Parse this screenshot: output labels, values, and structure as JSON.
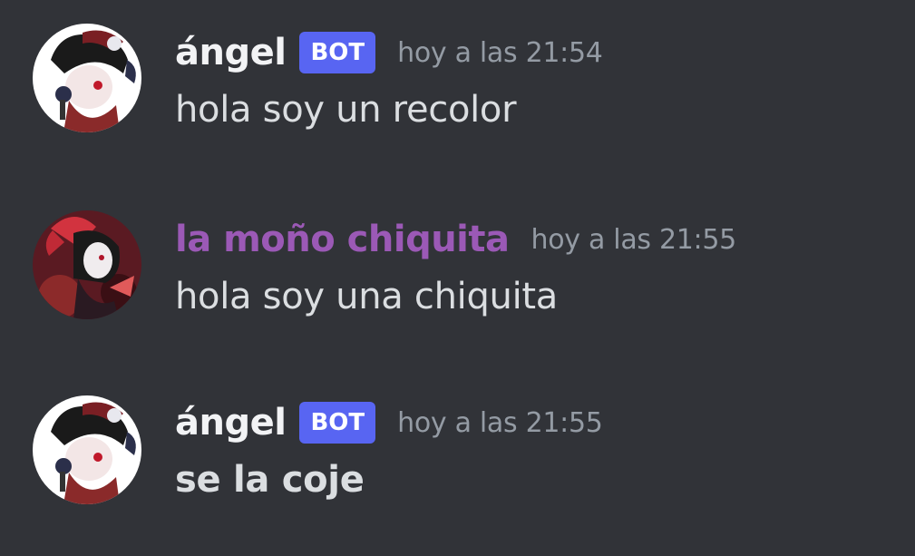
{
  "messages": [
    {
      "author": "ángel",
      "bot_tag": "BOT",
      "timestamp": "hoy a las 21:54",
      "text": "hola soy un recolor",
      "avatar_icon": "red-haired-character-with-microphone-avatar"
    },
    {
      "author": "la moño chiquita",
      "author_color": "#9b59b6",
      "timestamp": "hoy a las 21:55",
      "text": "hola soy una chiquita",
      "avatar_icon": "girl-with-red-bow-avatar"
    },
    {
      "author": "ángel",
      "bot_tag": "BOT",
      "timestamp": "hoy a las 21:55",
      "text": "se la coje",
      "avatar_icon": "red-haired-character-with-microphone-avatar"
    }
  ],
  "colors": {
    "background": "#313338",
    "bot_tag": "#5865f2",
    "username": "#f2f3f5",
    "timestamp": "#949ba4",
    "message_text": "#dbdee1"
  }
}
